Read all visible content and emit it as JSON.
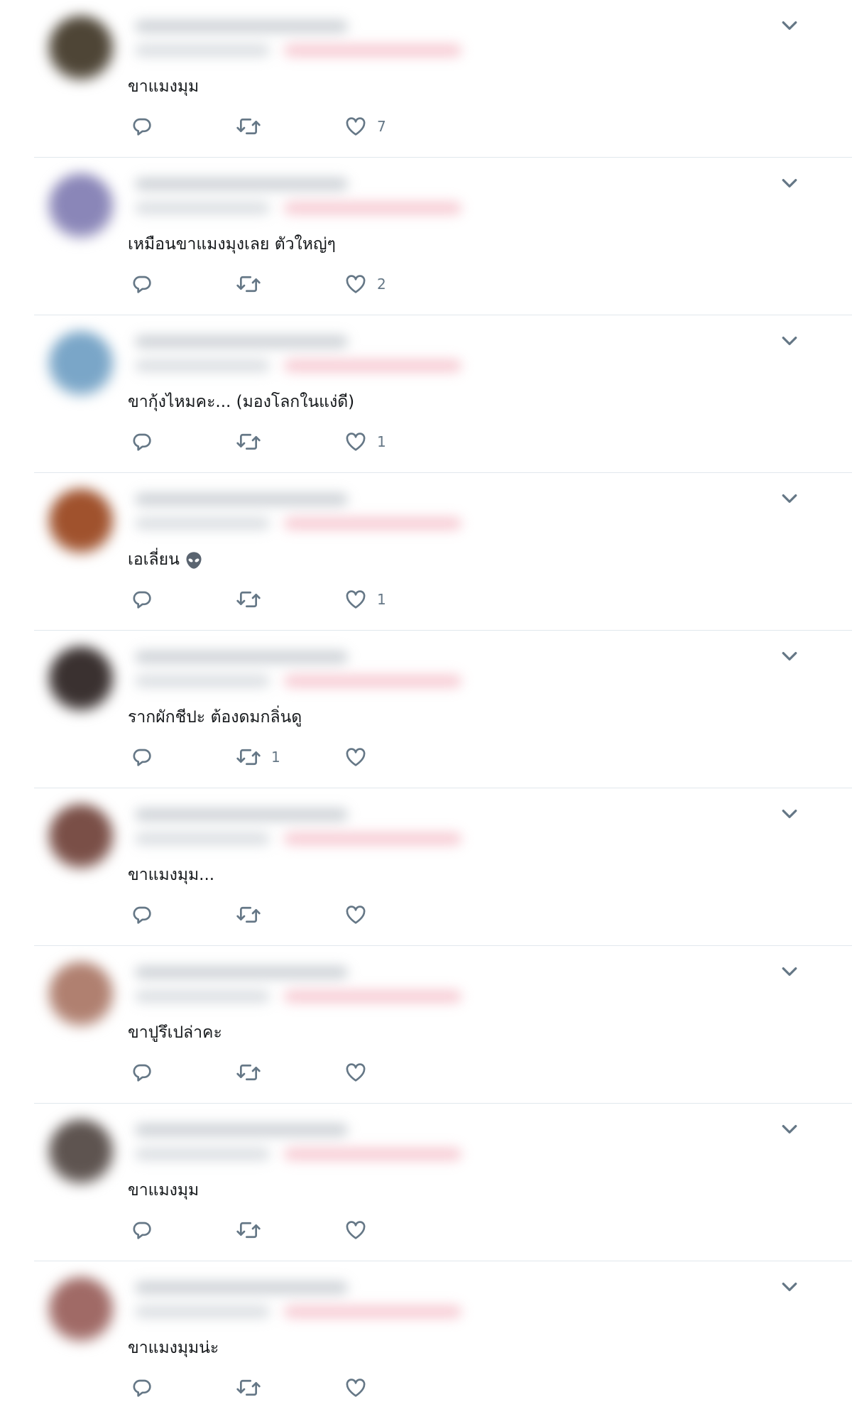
{
  "icons": {
    "reply": "reply-icon",
    "retweet": "retweet-icon",
    "like": "heart-icon",
    "more": "chevron-down-icon",
    "alien": "alien-emoji"
  },
  "colors": {
    "icon": "#657786",
    "text": "#14171a",
    "divider": "#e1e8ed"
  },
  "replies": [
    {
      "text": "ขาแมงมุม",
      "reply_count": "",
      "retweet_count": "",
      "like_count": "7",
      "avatar_color": "#4e4536"
    },
    {
      "text": "เหมือนขาแมงมุงเลย ตัวใหญ่ๆ",
      "reply_count": "",
      "retweet_count": "",
      "like_count": "2",
      "avatar_color": "#8a86b8"
    },
    {
      "text": "ขากุ้งไหมคะ... (มองโลกในแง่ดี)",
      "reply_count": "",
      "retweet_count": "",
      "like_count": "1",
      "avatar_color": "#7aa6c8"
    },
    {
      "text": "เอเลี่ยน",
      "reply_count": "",
      "retweet_count": "",
      "like_count": "1",
      "avatar_color": "#a0522d"
    },
    {
      "text": "รากผักชีปะ ต้องดมกลิ่นดู",
      "reply_count": "",
      "retweet_count": "1",
      "like_count": "",
      "avatar_color": "#3a3130"
    },
    {
      "text": "ขาแมงมุม...",
      "reply_count": "",
      "retweet_count": "",
      "like_count": "",
      "avatar_color": "#7a4f47"
    },
    {
      "text": "ขาปูรึเปล่าคะ",
      "reply_count": "",
      "retweet_count": "",
      "like_count": "",
      "avatar_color": "#b08070"
    },
    {
      "text": "ขาแมงมุม",
      "reply_count": "",
      "retweet_count": "",
      "like_count": "",
      "avatar_color": "#5e5450"
    },
    {
      "text": "ขาแมงมุมน่ะ",
      "reply_count": "",
      "retweet_count": "",
      "like_count": "",
      "avatar_color": "#a06a66"
    }
  ]
}
